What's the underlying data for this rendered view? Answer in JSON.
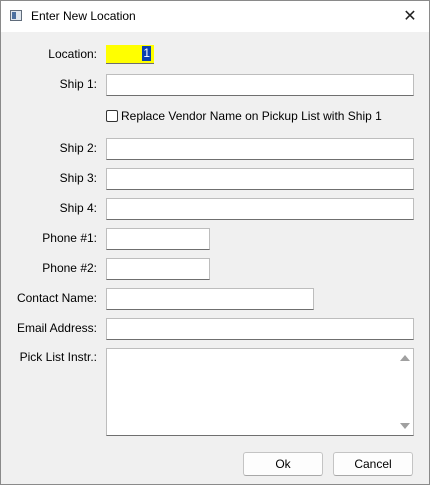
{
  "window": {
    "title": "Enter New Location",
    "close_glyph": "✕"
  },
  "form": {
    "location": {
      "label": "Location:",
      "value": "1"
    },
    "ship1": {
      "label": "Ship 1:",
      "value": ""
    },
    "replace_vendor": {
      "label": "Replace Vendor Name on Pickup List with Ship 1",
      "checked": false
    },
    "ship2": {
      "label": "Ship 2:",
      "value": ""
    },
    "ship3": {
      "label": "Ship 3:",
      "value": ""
    },
    "ship4": {
      "label": "Ship 4:",
      "value": ""
    },
    "phone1": {
      "label": "Phone #1:",
      "value": ""
    },
    "phone2": {
      "label": "Phone #2:",
      "value": ""
    },
    "contact_name": {
      "label": "Contact Name:",
      "value": ""
    },
    "email": {
      "label": "Email Address:",
      "value": ""
    },
    "pick_list": {
      "label": "Pick List Instr.:",
      "value": ""
    }
  },
  "buttons": {
    "ok": "Ok",
    "cancel": "Cancel"
  },
  "colors": {
    "location_highlight": "#ffff00",
    "selection": "#0a3fb0"
  }
}
